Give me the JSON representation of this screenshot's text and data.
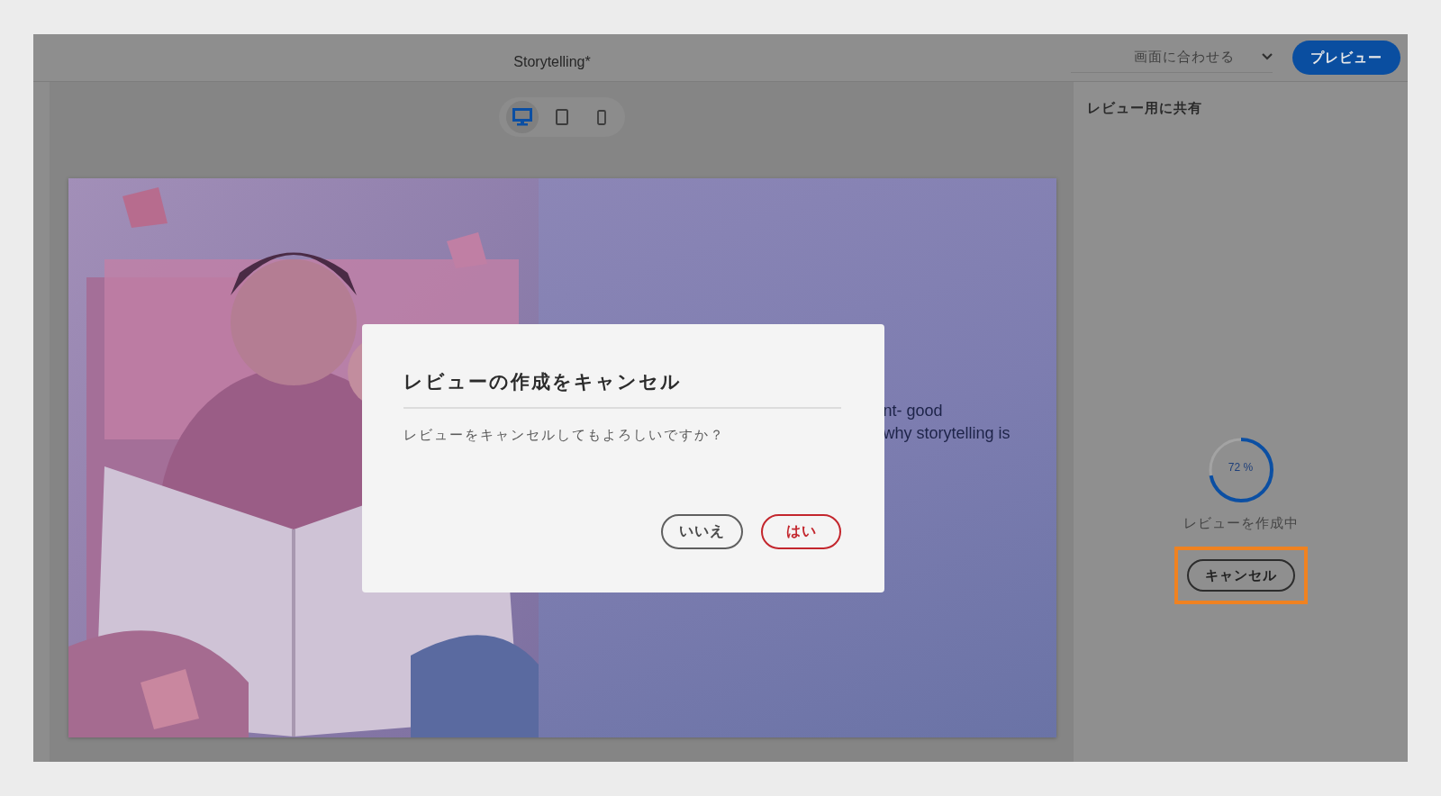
{
  "window": {
    "title": "Storytelling*"
  },
  "toolbar": {
    "zoom_select": {
      "value": "画面に合わせる"
    },
    "preview_button": "プレビュー"
  },
  "device_switcher": [
    {
      "kind": "desktop",
      "selected": true
    },
    {
      "kind": "tablet",
      "selected": false
    },
    {
      "kind": "phone",
      "selected": false
    }
  ],
  "slide": {
    "picture": {
      "kind": "picture"
    },
    "text_lines": [
      "nt- good",
      "why storytelling is"
    ]
  },
  "review_panel": {
    "title": "レビュー用に共有",
    "progress": {
      "reading": "72 %"
    },
    "status": "レビューを作成中",
    "cancel_button": {
      "label": "キャンセル",
      "focused": true
    }
  },
  "dialog": {
    "title": "レビューの作成をキャンセル",
    "message": "レビューをキャンセルしてもよろしいですか？",
    "buttons": [
      {
        "label": "いいえ",
        "kind": "secondary"
      },
      {
        "label": "はい",
        "kind": "negative"
      }
    ]
  }
}
